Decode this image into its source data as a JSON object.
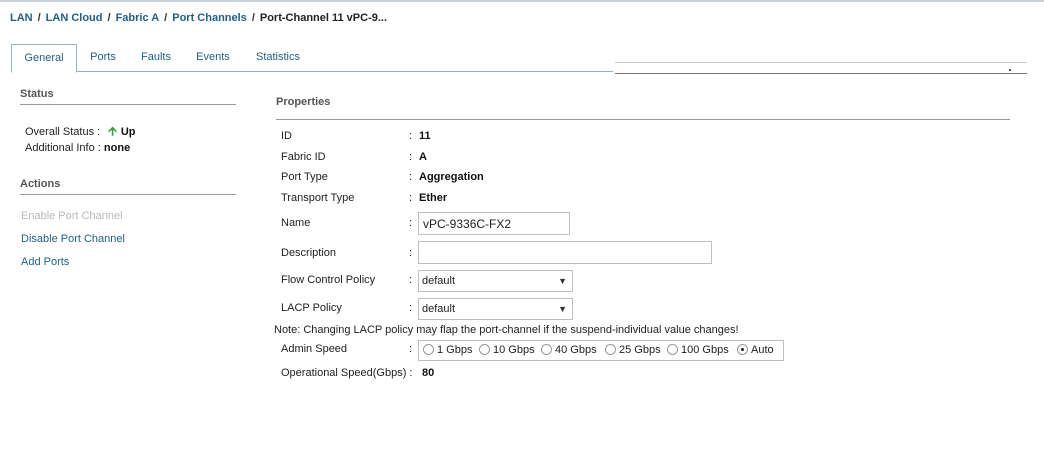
{
  "breadcrumb": {
    "items": [
      "LAN",
      "LAN Cloud",
      "Fabric A",
      "Port Channels"
    ],
    "current": "Port-Channel 11 vPC-9...",
    "separator": "/"
  },
  "tabs": [
    "General",
    "Ports",
    "Faults",
    "Events",
    "Statistics"
  ],
  "active_tab": "General",
  "status": {
    "title": "Status",
    "overall_label": "Overall Status :",
    "overall_value": "Up",
    "additional_label": "Additional Info :",
    "additional_value": "none"
  },
  "actions": {
    "title": "Actions",
    "items": [
      {
        "label": "Enable Port Channel",
        "enabled": false
      },
      {
        "label": "Disable Port Channel",
        "enabled": true
      },
      {
        "label": "Add Ports",
        "enabled": true
      }
    ]
  },
  "properties": {
    "title": "Properties",
    "colon": ":",
    "id": {
      "label": "ID",
      "value": "11"
    },
    "fabric_id": {
      "label": "Fabric ID",
      "value": "A"
    },
    "port_type": {
      "label": "Port Type",
      "value": "Aggregation"
    },
    "transport_type": {
      "label": "Transport Type",
      "value": "Ether"
    },
    "name": {
      "label": "Name",
      "value": "vPC-9336C-FX2"
    },
    "description": {
      "label": "Description",
      "value": ""
    },
    "flow_control": {
      "label": "Flow Control Policy",
      "value": "default"
    },
    "lacp": {
      "label": "LACP Policy",
      "value": "default"
    },
    "note": "Note: Changing LACP policy may flap the port-channel if the suspend-individual value changes!",
    "admin_speed": {
      "label": "Admin Speed",
      "options": [
        "1 Gbps",
        "10 Gbps",
        "40 Gbps",
        "25 Gbps",
        "100 Gbps",
        "Auto"
      ],
      "selected": "Auto"
    },
    "oper_speed": {
      "label": "Operational Speed(Gbps) :",
      "value": "80"
    }
  },
  "colors": {
    "link": "#1f5f86",
    "disabled": "#b9b9b9",
    "status_up": "#2ea043"
  },
  "icons": {
    "status_up": "up-arrow-icon",
    "dropdown": "chevron-down-icon"
  }
}
